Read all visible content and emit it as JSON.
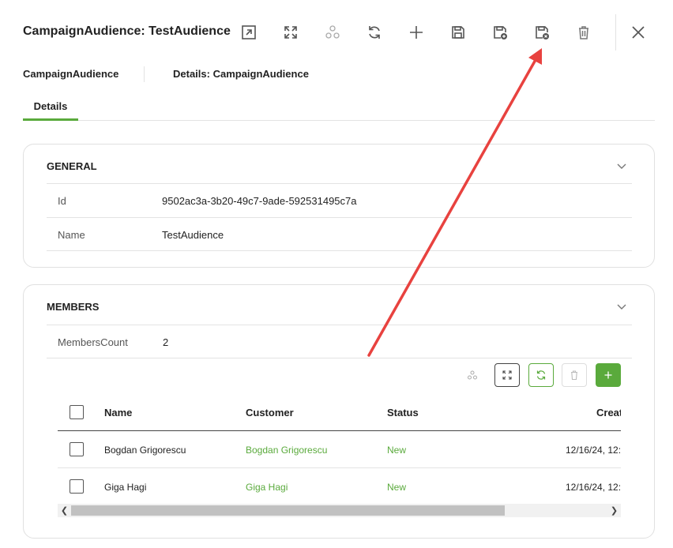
{
  "header": {
    "title": "CampaignAudience: TestAudience",
    "toolbar_icons": [
      "open-external-icon",
      "maximize-icon",
      "relations-icon",
      "refresh-icon",
      "add-icon",
      "save-icon",
      "save-add-icon",
      "save-close-icon",
      "trash-icon",
      "close-icon"
    ]
  },
  "breadcrumb": {
    "items": [
      "CampaignAudience",
      "Details: CampaignAudience"
    ]
  },
  "tabs": [
    {
      "label": "Details",
      "active": true
    }
  ],
  "general": {
    "title": "GENERAL",
    "fields": [
      {
        "label": "Id",
        "value": "9502ac3a-3b20-49c7-9ade-592531495c7a"
      },
      {
        "label": "Name",
        "value": "TestAudience"
      }
    ]
  },
  "members": {
    "title": "MEMBERS",
    "count_label": "MembersCount",
    "count_value": "2",
    "grid": {
      "columns": [
        "Name",
        "Customer",
        "Status",
        "Creat"
      ],
      "rows": [
        {
          "name": "Bogdan Grigorescu",
          "customer": "Bogdan Grigorescu",
          "status": "New",
          "created": "12/16/24, 12:"
        },
        {
          "name": "Giga Hagi",
          "customer": "Giga Hagi",
          "status": "New",
          "created": "12/16/24, 12:"
        }
      ]
    }
  },
  "colors": {
    "accent": "#5aaa3c",
    "annotation_arrow": "#e8423f"
  }
}
